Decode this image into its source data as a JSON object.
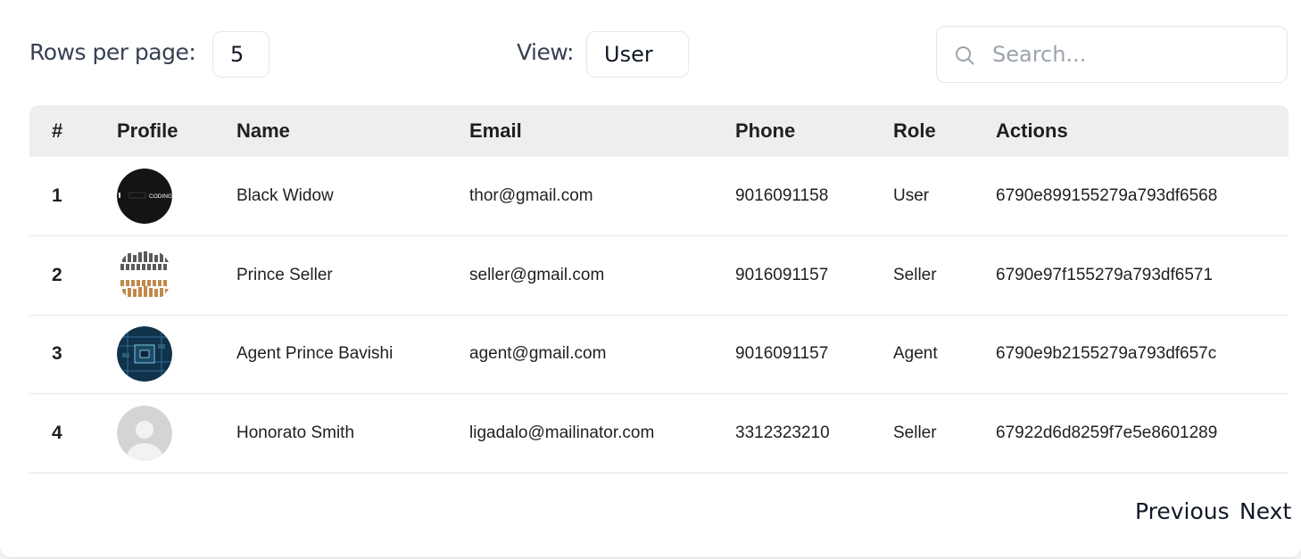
{
  "toolbar": {
    "rows_label": "Rows per page:",
    "rows_value": "5",
    "view_label": "View:",
    "view_value": "User",
    "search_placeholder": "Search..."
  },
  "table": {
    "headers": [
      "#",
      "Profile",
      "Name",
      "Email",
      "Phone",
      "Role",
      "Actions"
    ],
    "rows": [
      {
        "index": "1",
        "avatar": "coding-logo-avatar",
        "name": "Black Widow",
        "email": "thor@gmail.com",
        "phone": "9016091158",
        "role": "User",
        "action": "6790e899155279a793df6568"
      },
      {
        "index": "2",
        "avatar": "chess-pieces-avatar",
        "name": "Prince Seller",
        "email": "seller@gmail.com",
        "phone": "9016091157",
        "role": "Seller",
        "action": "6790e97f155279a793df6571"
      },
      {
        "index": "3",
        "avatar": "circuit-board-avatar",
        "name": "Agent Prince Bavishi",
        "email": "agent@gmail.com",
        "phone": "9016091157",
        "role": "Agent",
        "action": "6790e9b2155279a793df657c"
      },
      {
        "index": "4",
        "avatar": "default-user-avatar",
        "name": "Honorato Smith",
        "email": "ligadalo@mailinator.com",
        "phone": "3312323210",
        "role": "Seller",
        "action": "67922d6d8259f7e5e8601289"
      }
    ]
  },
  "pagination": {
    "previous": "Previous",
    "next": "Next"
  },
  "avatar_logo_text": "CODING"
}
